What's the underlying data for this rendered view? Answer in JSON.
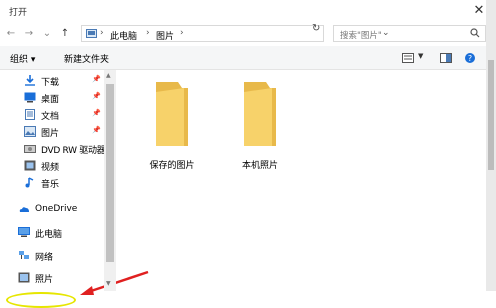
{
  "window": {
    "title": "打开",
    "close_glyph": "✕"
  },
  "address_bar": {
    "back": "←",
    "forward": "→",
    "recent": "⌄",
    "up": "↑",
    "crumbs": [
      "此电脑",
      "图片"
    ],
    "separator": "›",
    "refresh": "↻"
  },
  "search": {
    "placeholder": "搜索\"图片\"",
    "icon": "search-icon"
  },
  "toolbar": {
    "organize": "组织 ▾",
    "new_folder": "新建文件夹"
  },
  "sidebar": {
    "items": [
      {
        "label": "下载",
        "icon": "download-icon",
        "pinned": true
      },
      {
        "label": "桌面",
        "icon": "desktop-icon",
        "pinned": true
      },
      {
        "label": "文档",
        "icon": "document-icon",
        "pinned": true
      },
      {
        "label": "图片",
        "icon": "pictures-icon",
        "pinned": true
      },
      {
        "label": "DVD RW 驱动器",
        "icon": "dvd-drive-icon",
        "pinned": false
      },
      {
        "label": "视频",
        "icon": "video-icon",
        "pinned": false
      },
      {
        "label": "音乐",
        "icon": "music-icon",
        "pinned": false
      },
      {
        "label": "OneDrive",
        "icon": "onedrive-icon",
        "pinned": false
      },
      {
        "label": "此电脑",
        "icon": "computer-icon",
        "pinned": false
      },
      {
        "label": "网络",
        "icon": "network-icon",
        "pinned": false
      },
      {
        "label": "照片",
        "icon": "photos-icon",
        "pinned": false
      }
    ]
  },
  "files": [
    {
      "name": "保存的图片",
      "icon": "folder-icon"
    },
    {
      "name": "本机照片",
      "icon": "folder-icon"
    }
  ],
  "colors": {
    "folder": "#f7d26a",
    "folder_dark": "#e8b94a",
    "annotation_arrow": "#e02020",
    "highlight_ellipse": "#e6e600"
  }
}
